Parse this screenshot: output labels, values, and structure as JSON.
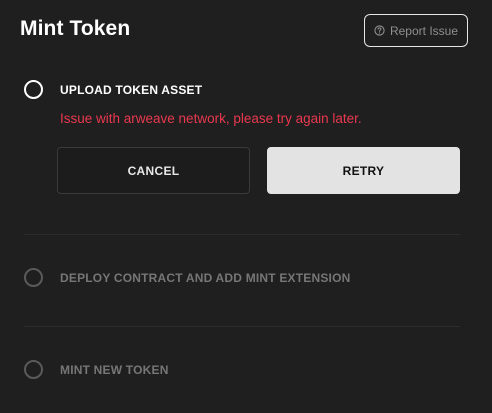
{
  "modal": {
    "title": "Mint Token",
    "report_issue_label": "Report Issue"
  },
  "steps": [
    {
      "label": "UPLOAD TOKEN ASSET",
      "state": "active"
    },
    {
      "label": "DEPLOY CONTRACT AND ADD MINT EXTENSION",
      "state": "pending"
    },
    {
      "label": "MINT NEW TOKEN",
      "state": "pending"
    }
  ],
  "error": {
    "message": "Issue with arweave network, please try again later."
  },
  "actions": {
    "cancel_label": "CANCEL",
    "retry_label": "RETRY"
  },
  "colors": {
    "background": "#1f1f1f",
    "error": "#e8384f",
    "retry_bg": "#e3e3e3"
  },
  "icons": {
    "report": "help-circle-icon"
  }
}
